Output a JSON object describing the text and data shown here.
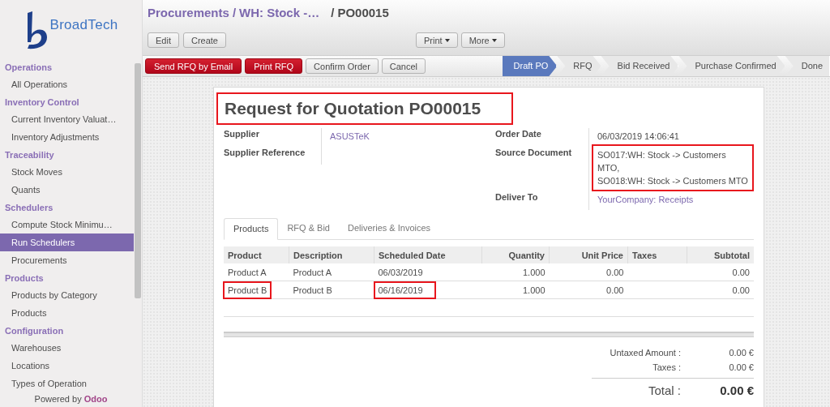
{
  "logo": {
    "text": "BroadTech"
  },
  "sidebar": {
    "sections": [
      {
        "title": "Operations",
        "items": [
          {
            "label": "All Operations",
            "selected": false
          }
        ]
      },
      {
        "title": "Inventory Control",
        "items": [
          {
            "label": "Current Inventory Valuat…",
            "selected": false
          },
          {
            "label": "Inventory Adjustments",
            "selected": false
          }
        ]
      },
      {
        "title": "Traceability",
        "items": [
          {
            "label": "Stock Moves",
            "selected": false
          },
          {
            "label": "Quants",
            "selected": false
          }
        ]
      },
      {
        "title": "Schedulers",
        "items": [
          {
            "label": "Compute Stock Minimu…",
            "selected": false
          },
          {
            "label": "Run Schedulers",
            "selected": true
          },
          {
            "label": "Procurements",
            "selected": false
          }
        ]
      },
      {
        "title": "Products",
        "items": [
          {
            "label": "Products by Category",
            "selected": false
          },
          {
            "label": "Products",
            "selected": false
          }
        ]
      },
      {
        "title": "Configuration",
        "items": [
          {
            "label": "Warehouses",
            "selected": false
          },
          {
            "label": "Locations",
            "selected": false
          },
          {
            "label": "Types of Operation",
            "selected": false
          }
        ]
      }
    ]
  },
  "powered_by": {
    "text": "Powered by",
    "brand": "Odoo"
  },
  "breadcrumb": {
    "separator": "/",
    "items": [
      {
        "label": "Procurements",
        "kind": "link"
      },
      {
        "label": "WH: Stock -…",
        "kind": "link"
      },
      {
        "label": "PO00015",
        "kind": "current"
      }
    ]
  },
  "toolbar": {
    "left": [
      {
        "label": "Edit"
      },
      {
        "label": "Create"
      }
    ],
    "right": [
      {
        "label": "Print"
      },
      {
        "label": "More"
      }
    ]
  },
  "actions": [
    {
      "label": "Send RFQ by Email",
      "kind": "primary"
    },
    {
      "label": "Print RFQ",
      "kind": "primary"
    },
    {
      "label": "Confirm Order",
      "kind": "default"
    },
    {
      "label": "Cancel",
      "kind": "default"
    }
  ],
  "statusbar": [
    {
      "label": "Draft PO",
      "selected": true
    },
    {
      "label": "RFQ",
      "selected": false
    },
    {
      "label": "Bid Received",
      "selected": false
    },
    {
      "label": "Purchase Confirmed",
      "selected": false
    },
    {
      "label": "Done",
      "selected": false
    }
  ],
  "form": {
    "title": "Request for Quotation PO00015",
    "highlighted": true,
    "left_fields": [
      {
        "label": "Supplier",
        "lines": [
          "ASUSTeK"
        ],
        "kind": "link"
      },
      {
        "label": "Supplier Reference"
      }
    ],
    "right_fields": [
      {
        "label": "Order Date",
        "lines": [
          "06/03/2019 14:06:41"
        ],
        "kind": "text"
      },
      {
        "label": "Source Document",
        "lines": [
          "SO017:WH: Stock -> Customers MTO,",
          "SO018:WH: Stock -> Customers MTO"
        ],
        "kind": "text",
        "highlighted": true
      },
      {
        "label": "Deliver To",
        "lines": [
          "YourCompany: Receipts"
        ],
        "kind": "link"
      }
    ]
  },
  "tabs": [
    {
      "label": "Products",
      "selected": true
    },
    {
      "label": "RFQ & Bid",
      "selected": false
    },
    {
      "label": "Deliveries & Invoices",
      "selected": false
    }
  ],
  "table": {
    "columns": [
      "Product",
      "Description",
      "Scheduled Date",
      "Quantity",
      "Unit Price",
      "Taxes",
      "Subtotal"
    ],
    "rows": [
      [
        {
          "text": "Product A"
        },
        {
          "text": "Product A"
        },
        {
          "text": "06/03/2019"
        },
        {
          "text": "1.000"
        },
        {
          "text": "0.00"
        },
        null,
        {
          "text": "0.00"
        }
      ],
      [
        {
          "text": "Product B",
          "highlighted": true
        },
        {
          "text": "Product B"
        },
        {
          "text": "06/16/2019",
          "highlighted": true
        },
        {
          "text": "1.000"
        },
        {
          "text": "0.00"
        },
        null,
        {
          "text": "0.00"
        }
      ]
    ]
  },
  "totals": [
    {
      "label": "Untaxed Amount :",
      "value": "0.00 €",
      "kind": "normal"
    },
    {
      "label": "Taxes :",
      "value": "0.00 €",
      "kind": "normal"
    },
    {
      "label": "Total :",
      "value": "0.00 €",
      "kind": "grand"
    }
  ]
}
